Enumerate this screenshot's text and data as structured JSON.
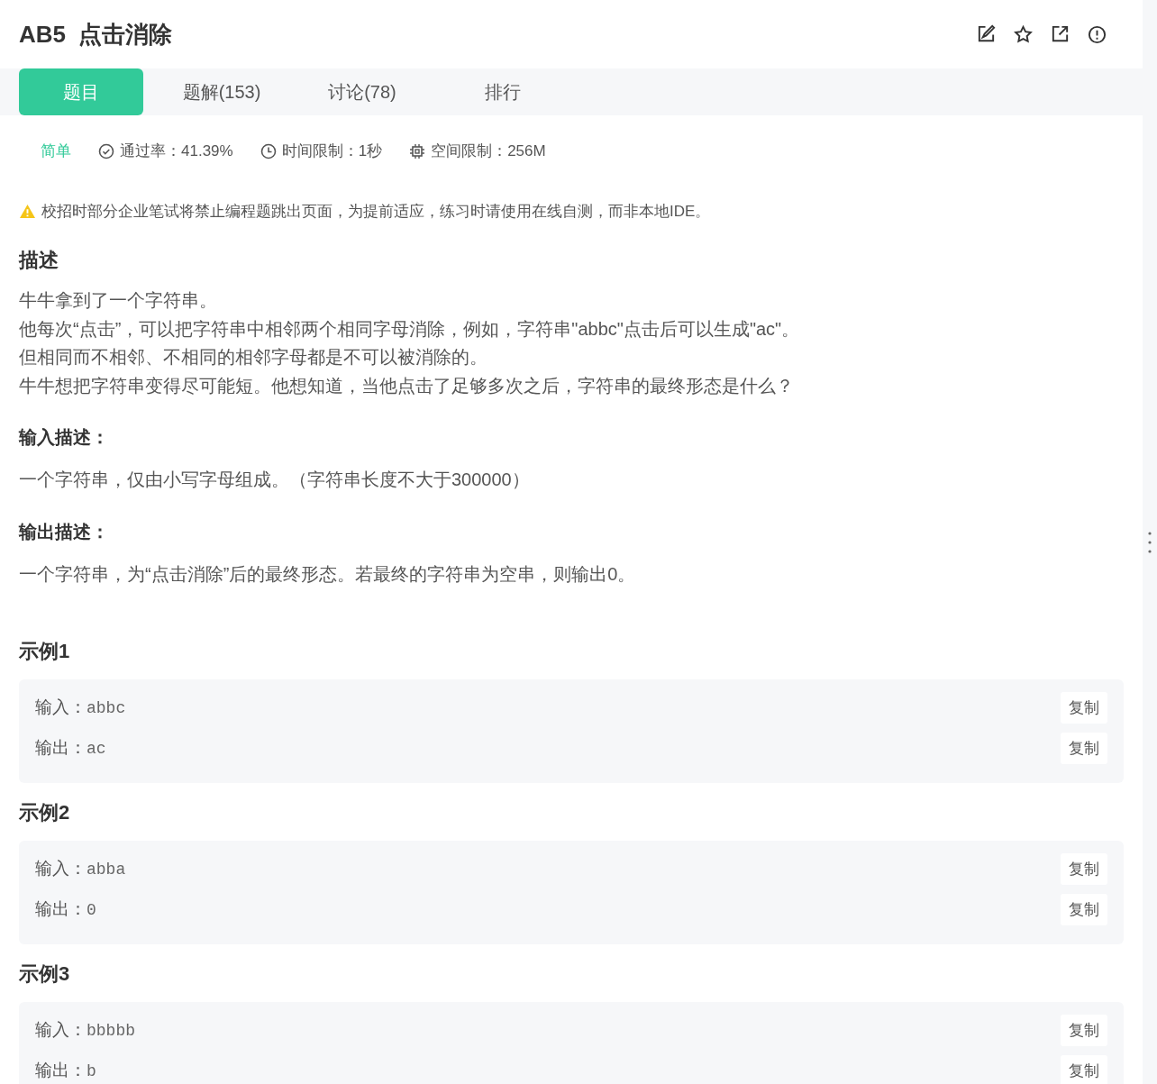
{
  "title": {
    "code": "AB5",
    "name": "点击消除"
  },
  "tabs": [
    {
      "label": "题目",
      "selected": true
    },
    {
      "label": "题解(153)",
      "selected": false
    },
    {
      "label": "讨论(78)",
      "selected": false
    },
    {
      "label": "排行",
      "selected": false
    }
  ],
  "meta": {
    "difficulty": "简单",
    "pass_rate": "通过率：41.39%",
    "time_limit": "时间限制：1秒",
    "memory_limit": "空间限制：256M"
  },
  "notice": "校招时部分企业笔试将禁止编程题跳出页面，为提前适应，练习时请使用在线自测，而非本地IDE。",
  "sections": [
    {
      "heading": "描述",
      "lines": [
        "牛牛拿到了一个字符串。",
        "他每次“点击”，可以把字符串中相邻两个相同字母消除，例如，字符串\"abbc\"点击后可以生成\"ac\"。",
        "但相同而不相邻、不相同的相邻字母都是不可以被消除的。",
        "牛牛想把字符串变得尽可能短。他想知道，当他点击了足够多次之后，字符串的最终形态是什么？"
      ]
    },
    {
      "heading": "输入描述：",
      "lines": [
        "一个字符串，仅由小写字母组成。（字符串长度不大于300000）"
      ]
    },
    {
      "heading": "输出描述：",
      "lines": [
        "一个字符串，为“点击消除”后的最终形态。若最终的字符串为空串，则输出0。"
      ]
    }
  ],
  "examples": [
    {
      "title": "示例1",
      "rows": [
        {
          "label": "输入：",
          "value": "abbc",
          "copy": "复制"
        },
        {
          "label": "输出：",
          "value": "ac",
          "copy": "复制"
        }
      ]
    },
    {
      "title": "示例2",
      "rows": [
        {
          "label": "输入：",
          "value": "abba",
          "copy": "复制"
        },
        {
          "label": "输出：",
          "value": "0",
          "copy": "复制"
        }
      ]
    },
    {
      "title": "示例3",
      "rows": [
        {
          "label": "输入：",
          "value": "bbbbb",
          "copy": "复制"
        },
        {
          "label": "输出：",
          "value": "b",
          "copy": "复制"
        }
      ]
    }
  ]
}
